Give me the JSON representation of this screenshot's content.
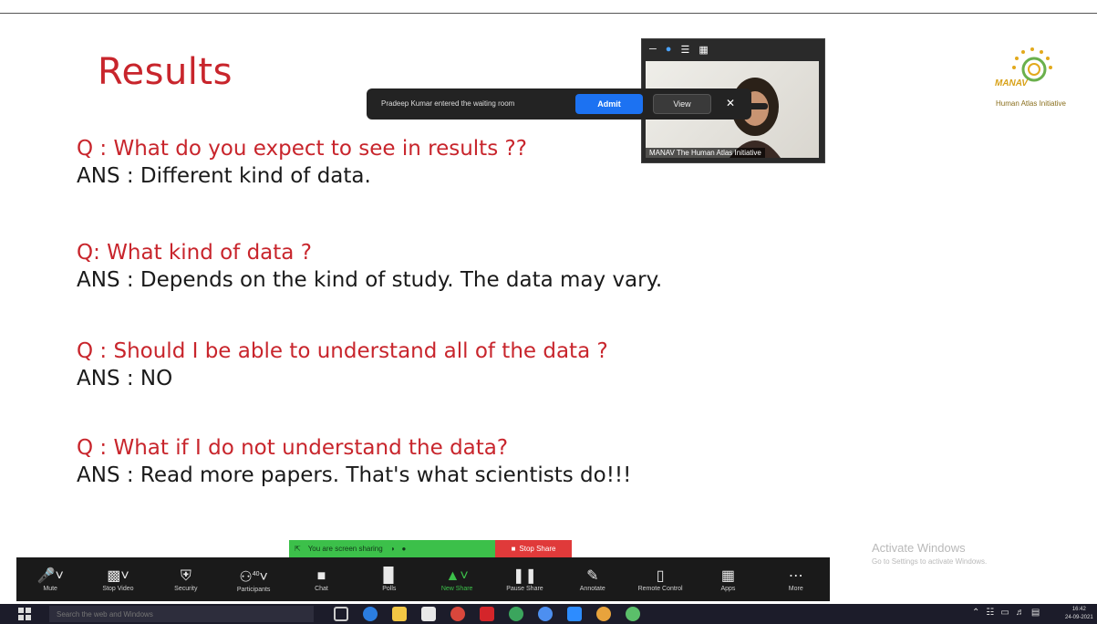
{
  "slide": {
    "title": "Results",
    "qa": [
      {
        "q": "Q : What do you expect to see in results ??",
        "a": "ANS : Different kind of data."
      },
      {
        "q": "Q: What kind of data ?",
        "a": "ANS : Depends on the kind of study. The data may vary."
      },
      {
        "q": "Q : Should I be able to understand all of the data ?",
        "a": "ANS : NO"
      },
      {
        "q": "Q : What if I do not understand the data?",
        "a": "ANS : Read more papers. That's what scientists do!!!"
      }
    ]
  },
  "logo": {
    "brand": "MANAV",
    "subtitle": "Human Atlas Initiative"
  },
  "video": {
    "name_tag": "MANAV The Human Atlas Initiative"
  },
  "notification": {
    "message": "Pradeep Kumar entered the waiting room",
    "admit_label": "Admit",
    "view_label": "View",
    "close_icon": "close-icon"
  },
  "share_indicator": {
    "text": "You are screen sharing",
    "stop_label": "Stop Share"
  },
  "toolbar": {
    "items": [
      {
        "label": "Mute",
        "icon": "microphone-icon"
      },
      {
        "label": "Stop Video",
        "icon": "video-camera-icon"
      },
      {
        "label": "Security",
        "icon": "shield-icon"
      },
      {
        "label": "Participants",
        "icon": "participants-icon",
        "count": "40"
      },
      {
        "label": "Chat",
        "icon": "chat-icon"
      },
      {
        "label": "Polls",
        "icon": "polls-icon"
      },
      {
        "label": "New Share",
        "icon": "share-screen-icon"
      },
      {
        "label": "Pause Share",
        "icon": "pause-icon"
      },
      {
        "label": "Annotate",
        "icon": "pencil-icon"
      },
      {
        "label": "Remote Control",
        "icon": "mouse-icon"
      },
      {
        "label": "Apps",
        "icon": "apps-icon"
      },
      {
        "label": "More",
        "icon": "more-icon"
      }
    ]
  },
  "activate_windows": {
    "title": "Activate Windows",
    "subtitle": "Go to Settings to activate Windows."
  },
  "taskbar": {
    "search_placeholder": "Search the web and Windows",
    "clock_time": "16:42",
    "clock_date": "24-09-2021"
  },
  "colors": {
    "accent_red": "#c8252c",
    "zoom_blue": "#1c72f2",
    "share_green": "#3cc04a",
    "stop_red": "#e03a3a"
  }
}
